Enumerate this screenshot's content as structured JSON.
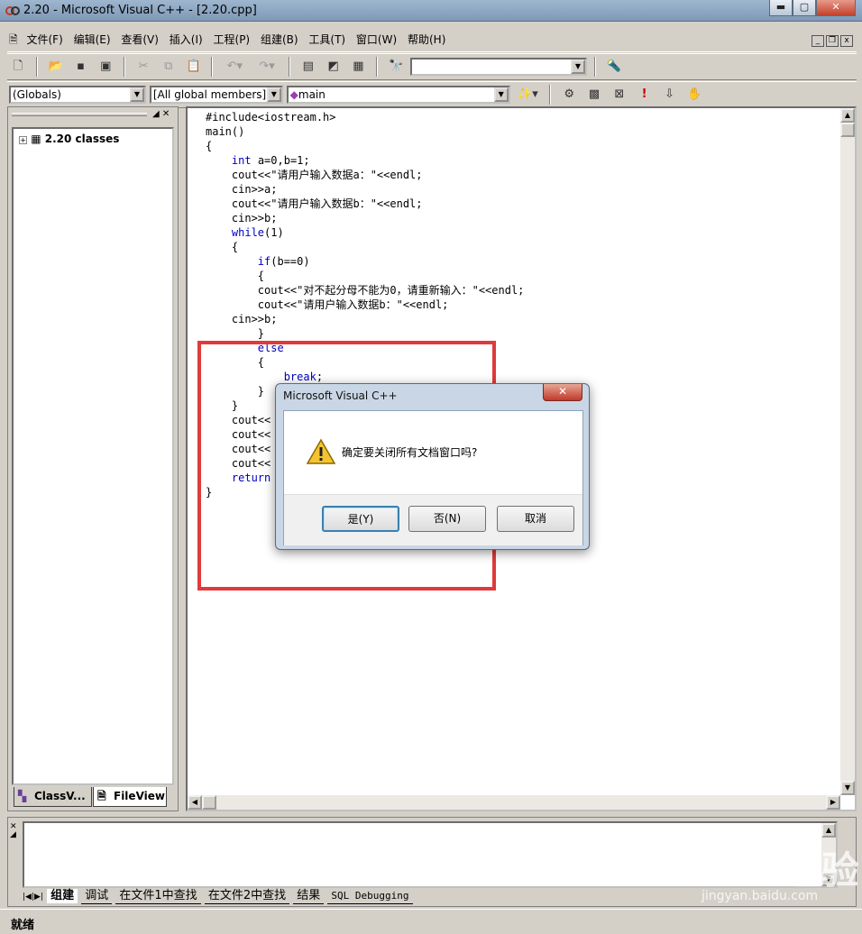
{
  "window": {
    "title": "2.20 - Microsoft Visual C++ - [2.20.cpp]",
    "min": "▬",
    "max": "▢",
    "close": "✕"
  },
  "menu": {
    "items": [
      "文件(F)",
      "编辑(E)",
      "查看(V)",
      "插入(I)",
      "工程(P)",
      "组建(B)",
      "工具(T)",
      "窗口(W)",
      "帮助(H)"
    ]
  },
  "toolbar2": {
    "globals": "(Globals)",
    "members": "[All global members]",
    "function": "main"
  },
  "workspace": {
    "tree_root": "2.20 classes",
    "tab_class": "ClassV...",
    "tab_file": "FileView"
  },
  "editor": {
    "lines": [
      {
        "t": "#include<iostream.h>"
      },
      {
        "t": "main()"
      },
      {
        "t": "{"
      },
      {
        "i": "    ",
        "k": "int",
        "t": " a=0,b=1;"
      },
      {
        "t": "    cout<<\"请用户输入数据a：\"<<endl;"
      },
      {
        "t": "    cin>>a;"
      },
      {
        "t": "    cout<<\"请用户输入数据b：\"<<endl;"
      },
      {
        "t": "    cin>>b;"
      },
      {
        "i": "    ",
        "k": "while",
        "t": "(1)"
      },
      {
        "t": "    {"
      },
      {
        "i": "        ",
        "k": "if",
        "t": "(b==0)"
      },
      {
        "t": "        {"
      },
      {
        "t": "        cout<<\"对不起分母不能为0，请重新输入：\"<<endl;"
      },
      {
        "t": "        cout<<\"请用户输入数据b：\"<<endl;"
      },
      {
        "t": "    cin>>b;"
      },
      {
        "t": "        }"
      },
      {
        "i": "        ",
        "k": "else",
        "t": ""
      },
      {
        "t": "        {"
      },
      {
        "i": "            ",
        "k": "break",
        "t": ";"
      },
      {
        "t": "        }"
      },
      {
        "t": "    }"
      },
      {
        "t": "    cout<<"
      },
      {
        "t": "    cout<<"
      },
      {
        "t": "    cout<<"
      },
      {
        "t": "    cout<<"
      },
      {
        "i": "    ",
        "k": "return",
        "t": ""
      },
      {
        "t": "}"
      }
    ]
  },
  "dialog": {
    "title": "Microsoft Visual C++",
    "close": "✕",
    "message": "确定要关闭所有文档窗口吗?",
    "yes": "是(Y)",
    "no": "否(N)",
    "cancel": "取消"
  },
  "output": {
    "tabs": [
      "组建",
      "调试",
      "在文件1中查找",
      "在文件2中查找",
      "结果",
      "SQL Debugging"
    ]
  },
  "status": {
    "text": "就绪"
  },
  "watermark": {
    "brand": "Baidu经验",
    "url": "jingyan.baidu.com"
  },
  "colors": {
    "keyword": "#0000c0",
    "highlight": "#e03a3a"
  }
}
